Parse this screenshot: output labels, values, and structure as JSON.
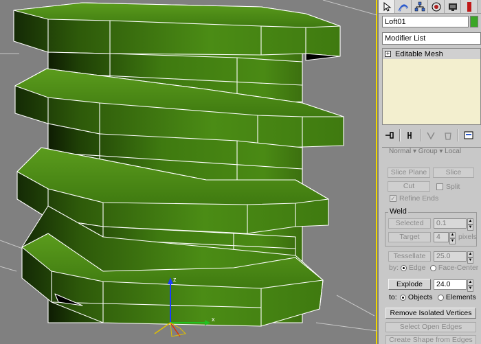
{
  "viewport": {
    "background": "#808080",
    "mesh_color": "#3f7a10",
    "border_color": "#f2d800",
    "axis": {
      "x_label": "x",
      "y_label": "y",
      "z_label": "z"
    }
  },
  "command_panel": {
    "tabs": [
      "select-arrow-icon",
      "create-icon",
      "hierarchy-icon",
      "motion-icon",
      "display-icon",
      "utilities-icon"
    ],
    "object_name": "Loft01",
    "object_color": "#3aa626",
    "modifier_list": "Modifier List",
    "stack": [
      {
        "label": "Editable Mesh"
      }
    ],
    "rollout_header": "Normal ▾  Group ▾  Local",
    "slice_plane": "Slice Plane",
    "slice": "Slice",
    "cut": "Cut",
    "split": "Split",
    "refine_ends": "Refine Ends",
    "weld_title": "Weld",
    "selected": "Selected",
    "selected_value": "0.1",
    "target": "Target",
    "target_value": "4",
    "pixels": "pixels",
    "tessellate": "Tessellate",
    "tessellate_value": "25.0",
    "by": "by:",
    "edge": "Edge",
    "face_center": "Face-Center",
    "explode": "Explode",
    "explode_value": "24.0",
    "to": "to:",
    "objects": "Objects",
    "elements": "Elements",
    "remove_isolated": "Remove Isolated Vertices",
    "select_open_edges": "Select Open Edges",
    "create_shape": "Create Shape from Edges"
  }
}
